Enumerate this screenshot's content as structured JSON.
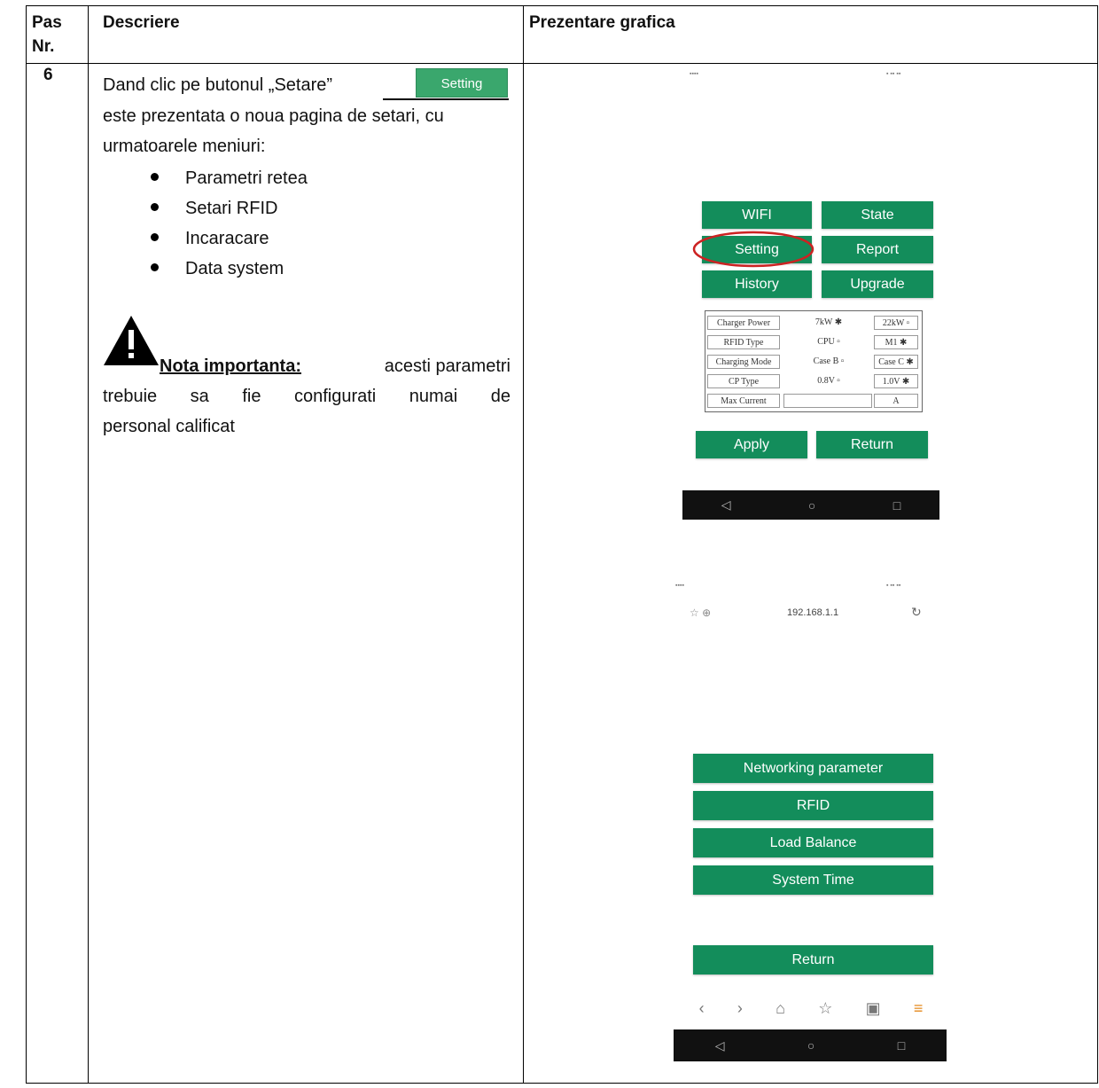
{
  "header": {
    "col1": "Pas\nNr.",
    "col1_line1": "Pas",
    "col1_line2": "Nr.",
    "col2": "Descriere",
    "col3": "Prezentare grafica"
  },
  "step": {
    "number": "6",
    "intro_line1": "Dand clic pe butonul „Setare”",
    "inline_button": "Setting",
    "intro_line2": "este prezentata o noua pagina de setari, cu",
    "intro_line3": "urmatoarele meniuri:",
    "menus": [
      "Parametri retea",
      "Setari RFID",
      "Incaracare",
      "Data system"
    ],
    "note_title": "Nota importanta:",
    "note_line1_rest": "acesti parametri",
    "note_line2_words": [
      "trebuie",
      "sa",
      "fie",
      "configurati",
      "numai",
      "de"
    ],
    "note_line3": "personal calificat"
  },
  "screen1": {
    "buttons": [
      "WIFI",
      "State",
      "Setting",
      "Report",
      "History",
      "Upgrade"
    ],
    "config_rows": [
      {
        "label": "Charger Power",
        "opt1": "7kW",
        "opt2": "22kW"
      },
      {
        "label": "RFID Type",
        "opt1": "CPU",
        "opt2": "M1"
      },
      {
        "label": "Charging Mode",
        "opt1": "Case B",
        "opt2": "Case C"
      },
      {
        "label": "CP Type",
        "opt1": "0.8V",
        "opt2": "1.0V"
      },
      {
        "label": "Max Current",
        "opt1": "",
        "opt2": "A"
      }
    ],
    "apply": "Apply",
    "return": "Return"
  },
  "screen2": {
    "url": "192.168.1.1",
    "buttons": [
      "Networking parameter",
      "RFID",
      "Load Balance",
      "System Time"
    ],
    "return": "Return"
  },
  "colors": {
    "button_green": "#138d5b",
    "circle": "#cc2222"
  }
}
